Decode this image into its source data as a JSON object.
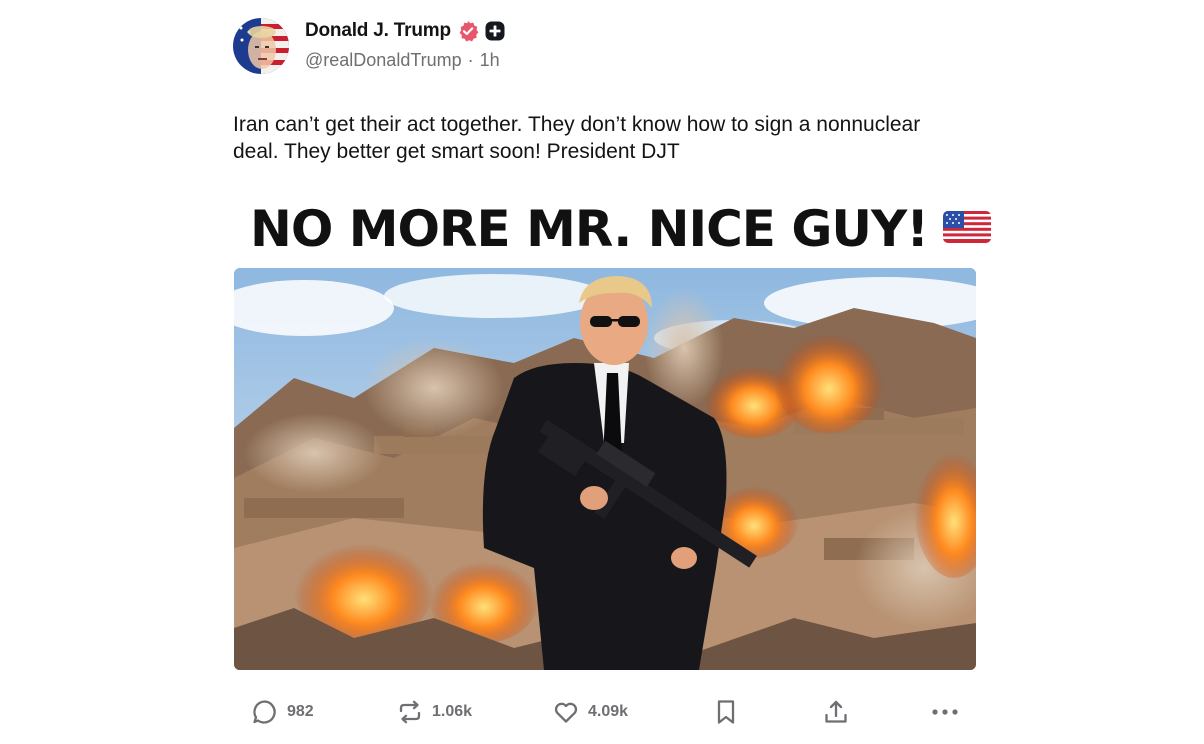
{
  "post": {
    "author": {
      "display_name": "Donald J. Trump",
      "handle": "@realDonaldTrump",
      "separator": "·",
      "time_ago": "1h",
      "verified_color": "#e8566e",
      "plus_badge_color": "#15181f"
    },
    "text": "Iran can’t get their act together. They don’t know how to sign a nonnuclear deal. They better get smart soon! President DJT",
    "media": {
      "headline": "NO MORE MR. NICE GUY!",
      "headline_emoji": "us-flag"
    },
    "actions": {
      "replies": "982",
      "reposts": "1.06k",
      "likes": "4.09k",
      "bookmark_icon": "bookmark-icon",
      "share_icon": "share-icon",
      "more_icon": "more-icon"
    }
  }
}
